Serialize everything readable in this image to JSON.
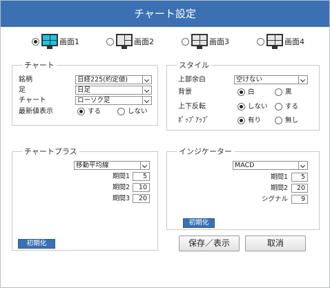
{
  "title": "チャート設定",
  "screens": [
    {
      "label": "画面1",
      "selected": true
    },
    {
      "label": "画面2",
      "selected": false
    },
    {
      "label": "画面3",
      "selected": false
    },
    {
      "label": "画面4",
      "selected": false
    }
  ],
  "chart": {
    "title": "チャート",
    "meigara_label": "銘柄",
    "meigara_value": "日経225(約定値)",
    "ashi_label": "足",
    "ashi_value": "日足",
    "chart_label": "チャート",
    "chart_value": "ローソク足",
    "latest_label": "最新値表示",
    "latest_on": "する",
    "latest_off": "しない"
  },
  "style": {
    "title": "スタイル",
    "margin_label": "上部余白",
    "margin_value": "空けない",
    "bg_label": "背景",
    "bg_white": "白",
    "bg_black": "黒",
    "flip_label": "上下反転",
    "flip_off": "しない",
    "flip_on": "する",
    "popup_label": "ﾎﾟｯﾌﾟｱｯﾌﾟ",
    "popup_on": "有り",
    "popup_off": "無し"
  },
  "chartplus": {
    "title": "チャートプラス",
    "type_value": "移動平均線",
    "p1_label": "期間1",
    "p1_value": "5",
    "p2_label": "期間2",
    "p2_value": "10",
    "p3_label": "期間3",
    "p3_value": "20",
    "init_label": "初期化"
  },
  "indicator": {
    "title": "インジケーター",
    "type_value": "MACD",
    "p1_label": "期間1",
    "p1_value": "5",
    "p2_label": "期間2",
    "p2_value": "20",
    "sig_label": "シグナル",
    "sig_value": "9",
    "init_label": "初期化"
  },
  "buttons": {
    "save": "保存／表示",
    "cancel": "取消"
  },
  "colors": {
    "accent": "#3b71b3",
    "screen_active": "#17c6e6"
  }
}
